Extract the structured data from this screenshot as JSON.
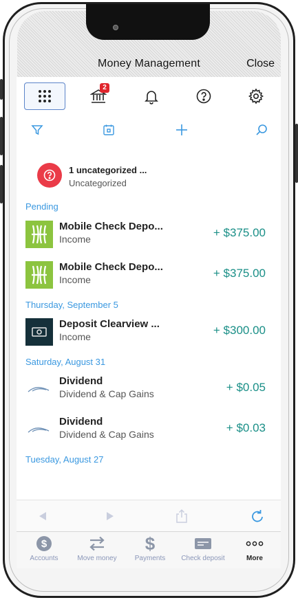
{
  "nav": {
    "title": "Money Management",
    "close_label": "Close"
  },
  "toolbar": {
    "items": [
      {
        "icon": "grid-icon",
        "active": true
      },
      {
        "icon": "bank-icon",
        "badge": "2"
      },
      {
        "icon": "bell-icon"
      },
      {
        "icon": "help-icon"
      },
      {
        "icon": "gear-icon"
      }
    ]
  },
  "actions": [
    "filter-icon",
    "calendar-icon",
    "plus-icon",
    "search-icon"
  ],
  "uncategorized": {
    "title": "1 uncategorized ...",
    "subtitle": "Uncategorized"
  },
  "groups": [
    {
      "header": "Pending",
      "items": [
        {
          "title": "Mobile Check Depo...",
          "category": "Income",
          "amount": "+ $375.00",
          "logo": "green-bank-logo"
        },
        {
          "title": "Mobile Check Depo...",
          "category": "Income",
          "amount": "+ $375.00",
          "logo": "green-bank-logo"
        }
      ]
    },
    {
      "header": "Thursday, September 5",
      "items": [
        {
          "title": "Deposit Clearview ...",
          "category": "Income",
          "amount": "+ $300.00",
          "logo": "cash-logo"
        }
      ]
    },
    {
      "header": "Saturday, August 31",
      "items": [
        {
          "title": "Dividend",
          "category": "Dividend & Cap Gains",
          "amount": "+ $0.05",
          "logo": "swoosh-logo"
        },
        {
          "title": "Dividend",
          "category": "Dividend & Cap Gains",
          "amount": "+ $0.03",
          "logo": "swoosh-logo"
        }
      ]
    },
    {
      "header": "Tuesday, August 27",
      "items": []
    }
  ],
  "browser_bar": [
    "back-arrow-icon",
    "forward-arrow-icon",
    "share-icon",
    "reload-icon"
  ],
  "tabs": [
    {
      "label": "Accounts",
      "icon": "dollar-circle-icon"
    },
    {
      "label": "Move money",
      "icon": "transfer-arrows-icon"
    },
    {
      "label": "Payments",
      "icon": "dollar-sign-icon"
    },
    {
      "label": "Check deposit",
      "icon": "check-card-icon"
    },
    {
      "label": "More",
      "icon": "more-dots-icon",
      "active": true
    }
  ],
  "colors": {
    "accent": "#3a98e0",
    "amount": "#1a8f87",
    "badge": "#e0262d",
    "alert": "#ea3b48"
  }
}
